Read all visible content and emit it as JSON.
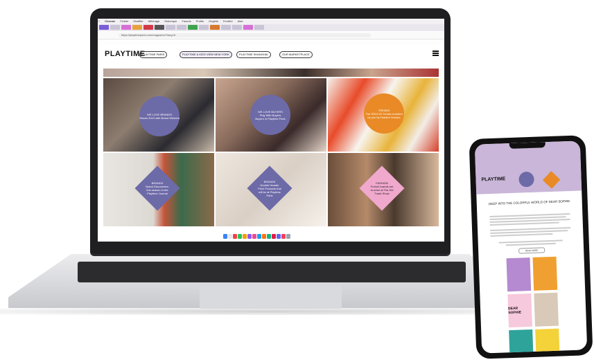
{
  "browser": {
    "menu_items": [
      "Chrome",
      "Fichier",
      "Modifier",
      "Affichage",
      "Historique",
      "Favoris",
      "Profils",
      "Onglets",
      "Fenêtre",
      "Aide"
    ],
    "url": "https://playtimeparis.com/magazine/?lang=fr"
  },
  "site": {
    "logo": "PLAYTIME",
    "nav": [
      "PLAYTIME PARIS",
      "PLAYTIME & KIDS VIEW NEW YORK",
      "PLAYTIME SHANGHAI",
      "OUR MARKETPLACE"
    ]
  },
  "cards": [
    {
      "text": "WE LOVE BRANDS\nShows 2019 with Brand Winners",
      "color": "#6d6aa8"
    },
    {
      "text": "WE LOVE BUYERS\nPlay With Buyers\nBuyers in Playtime Paris",
      "color": "#6d6aa8"
    },
    {
      "text": "TRENDS\nThe SS19-20 Trends revealed by you by Fashion Snoops",
      "color": "#e98a26"
    },
    {
      "text": "BRANDS\nBrand Discoveries: this season in the Playtime Journal",
      "color": "#6d6aa8"
    },
    {
      "text": "BRANDS\nDouble Header Pitch Products that will be at Playtime Paris",
      "color": "#6d6aa8"
    },
    {
      "text": "FASHION\nFrench brands set to enter at The Kid Trade Show",
      "color": "#f0a8cc"
    }
  ],
  "phone": {
    "logo": "PLAYTIME",
    "heading": "DEEP INTO THE COLORFUL WORLD OF DEAR SOPHIE",
    "button": "READ MORE",
    "tile_label": "DEAR SOPHIE"
  }
}
